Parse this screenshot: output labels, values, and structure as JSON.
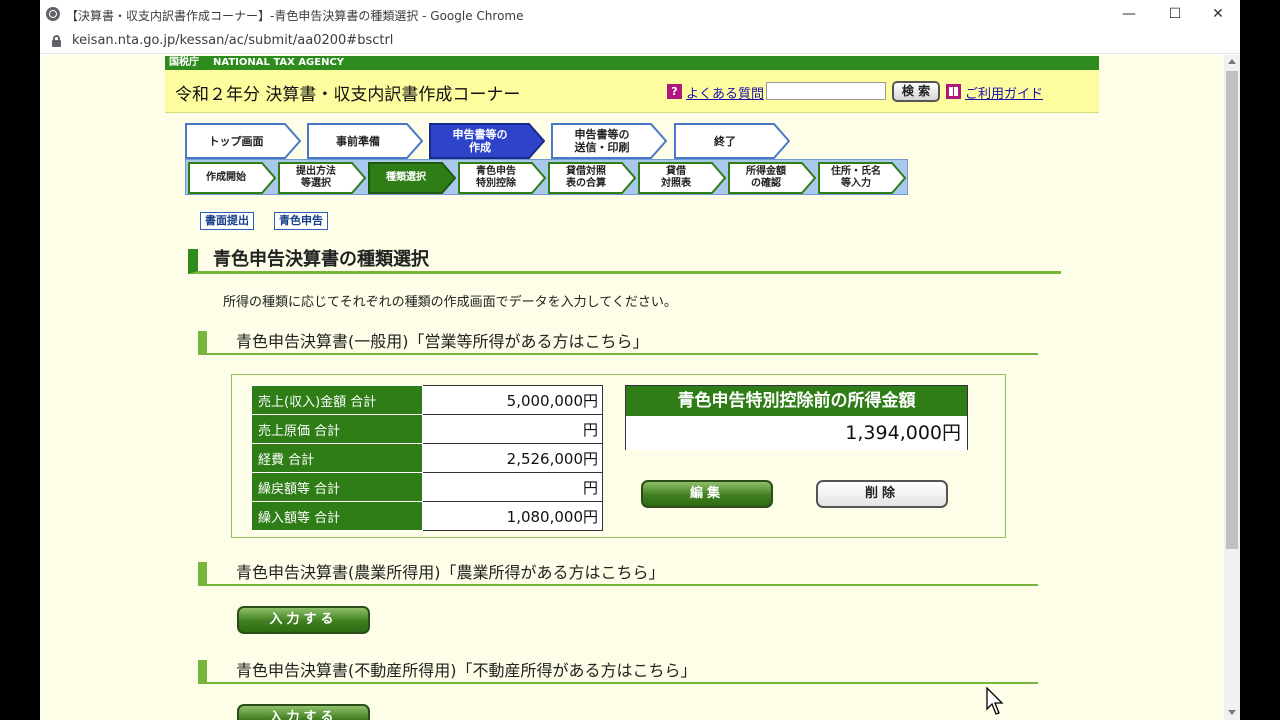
{
  "browser": {
    "tab_title": "【決算書・収支内訳書作成コーナー】-青色申告決算書の種類選択 - Google Chrome",
    "url": "keisan.nta.go.jp/kessan/ac/submit/aa0200#bsctrl",
    "minimize": "—",
    "maximize": "☐",
    "close": "✕"
  },
  "site": {
    "agency_ja": "国税庁",
    "agency_en": "NATIONAL TAX AGENCY",
    "corner_title": "令和２年分 決算書・収支内訳書作成コーナー",
    "faq_label": "よくある質問",
    "search_button": "検 索",
    "guide_label": "ご利用ガイド",
    "search_value": ""
  },
  "main_steps": [
    {
      "label": "トップ画面"
    },
    {
      "label": "事前準備"
    },
    {
      "label": "申告書等の\n作成"
    },
    {
      "label": "申告書等の\n送信・印刷"
    },
    {
      "label": "終了"
    }
  ],
  "sub_steps": [
    {
      "label": "作成開始"
    },
    {
      "label": "提出方法\n等選択"
    },
    {
      "label": "種類選択"
    },
    {
      "label": "青色申告\n特別控除"
    },
    {
      "label": "貸借対照\n表の合算"
    },
    {
      "label": "貸借\n対照表"
    },
    {
      "label": "所得金額\nの確認"
    },
    {
      "label": "住所・氏名\n等入力"
    }
  ],
  "tags": [
    "書面提出",
    "青色申告"
  ],
  "page": {
    "title": "青色申告決算書の種類選択",
    "instruction": "所得の種類に応じてそれぞれの種類の作成画面でデータを入力してください。"
  },
  "sections": {
    "general": {
      "heading": "青色申告決算書(一般用)「営業等所得がある方はこちら」",
      "rows": [
        {
          "label": "売上(収入)金額  合計",
          "value": "5,000,000円"
        },
        {
          "label": "売上原価  合計",
          "value": "円"
        },
        {
          "label": "経費  合計",
          "value": "2,526,000円"
        },
        {
          "label": "繰戻額等  合計",
          "value": "円"
        },
        {
          "label": "繰入額等  合計",
          "value": "1,080,000円"
        }
      ],
      "income_header": "青色申告特別控除前の所得金額",
      "income_value": "1,394,000円",
      "edit_button": "編集",
      "delete_button": "削除"
    },
    "agriculture": {
      "heading": "青色申告決算書(農業所得用)「農業所得がある方はこちら」",
      "input_button": "入力する"
    },
    "realestate": {
      "heading": "青色申告決算書(不動産所得用)「不動産所得がある方はこちら」",
      "input_button": "入力する"
    }
  },
  "colors": {
    "ribbon_green": "#2e8b1e",
    "header_yellow": "#fdfda0",
    "page_bg": "#fdfde8",
    "active_main_step": "#2d44c8",
    "active_sub_step": "#2e7d17",
    "link_blue": "#1a0dab"
  }
}
